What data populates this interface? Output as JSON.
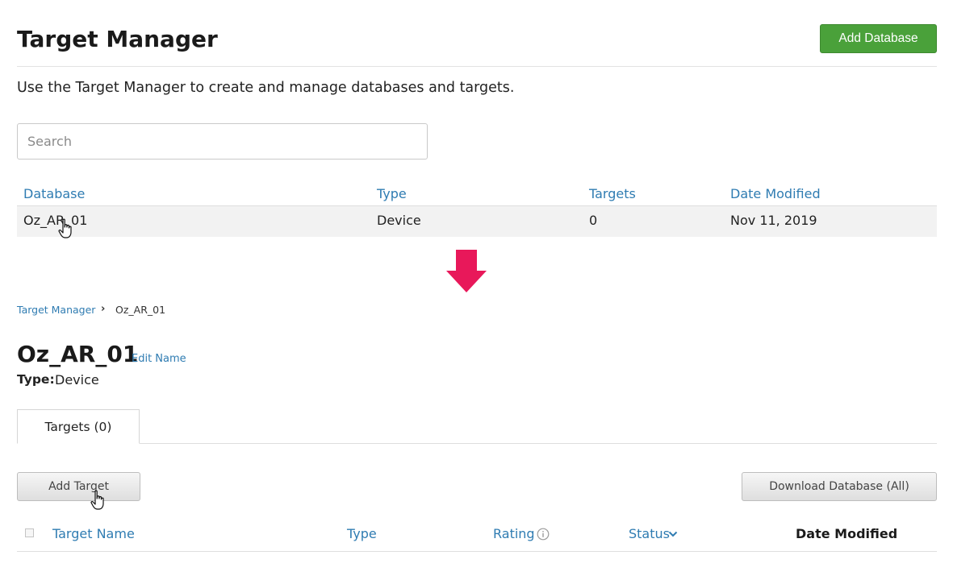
{
  "header": {
    "title": "Target Manager",
    "add_database_label": "Add Database"
  },
  "intro_text": "Use the Target Manager to create and manage databases and targets.",
  "search": {
    "placeholder": "Search",
    "value": ""
  },
  "database_table": {
    "headers": [
      "Database",
      "Type",
      "Targets",
      "Date Modified"
    ],
    "rows": [
      {
        "database": "Oz_AR_01",
        "type": "Device",
        "targets": "0",
        "date_modified": "Nov 11, 2019"
      }
    ]
  },
  "colors": {
    "accent_green": "#4aa13a",
    "link_blue": "#2f7cb2",
    "arrow_pink": "#e8185a"
  },
  "breadcrumb": {
    "root": "Target Manager",
    "separator": "›",
    "current": "Oz_AR_01"
  },
  "database_detail": {
    "name": "Oz_AR_01",
    "edit_name_label": "Edit Name",
    "type_label": "Type:",
    "type_value": "Device"
  },
  "tabs": [
    {
      "label": "Targets (0)",
      "active": true
    }
  ],
  "toolbar": {
    "add_target_label": "Add Target",
    "download_label": "Download Database (All)"
  },
  "targets_table": {
    "headers": {
      "target_name": "Target Name",
      "type": "Type",
      "rating": "Rating",
      "status": "Status",
      "date_modified": "Date Modified"
    },
    "rows": []
  },
  "icons": {
    "arrow": "down-arrow-icon",
    "info": "info-icon",
    "sort": "chevron-down-icon",
    "cursor": "hand-pointer-icon"
  }
}
